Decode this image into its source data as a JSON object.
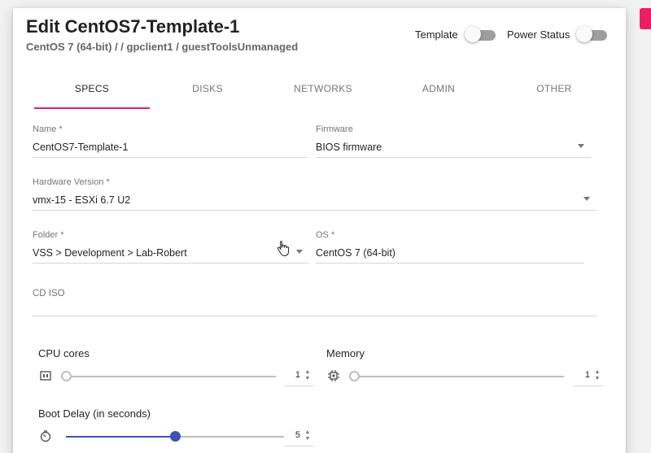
{
  "dialog": {
    "title": "Edit CentOS7-Template-1",
    "subtitle": "CentOS 7 (64-bit) / / gpclient1 / guestToolsUnmanaged"
  },
  "toggles": {
    "template_label": "Template",
    "template_on": false,
    "power_label": "Power Status",
    "power_on": false
  },
  "tabs": [
    "SPECS",
    "DISKS",
    "NETWORKS",
    "ADMIN",
    "OTHER"
  ],
  "active_tab": "SPECS",
  "form": {
    "name": {
      "label": "Name *",
      "value": "CentOS7-Template-1"
    },
    "firmware": {
      "label": "Firmware",
      "value": "BIOS firmware"
    },
    "hardware_version": {
      "label": "Hardware Version *",
      "value": "vmx-15 - ESXi 6.7 U2"
    },
    "folder": {
      "label": "Folder *",
      "value": "VSS > Development > Lab-Robert"
    },
    "os": {
      "label": "OS *",
      "value": "CentOS 7 (64-bit)"
    },
    "cd_iso": {
      "label": "CD ISO",
      "value": ""
    }
  },
  "sliders": {
    "cpu": {
      "label": "CPU cores",
      "value": "1",
      "icon": "cpu-icon"
    },
    "memory": {
      "label": "Memory",
      "value": "1",
      "icon": "memory-chip-icon"
    },
    "boot_delay": {
      "label": "Boot Delay (in seconds)",
      "value": "5",
      "icon": "timer-icon",
      "fill_fraction": 0.5
    }
  },
  "colors": {
    "accent": "#e91e63",
    "slider": "#3f51b5"
  }
}
